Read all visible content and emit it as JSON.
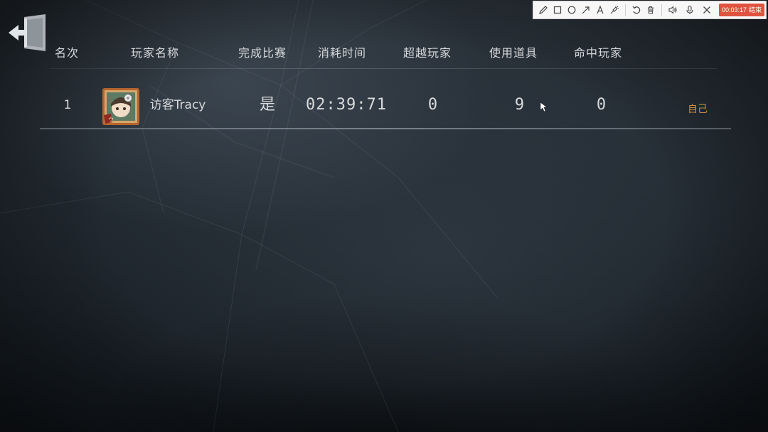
{
  "header": {
    "rank": "名次",
    "player_name": "玩家名称",
    "finished": "完成比赛",
    "time_used": "消耗时间",
    "players_overtaken": "超越玩家",
    "items_used": "使用道具",
    "players_hit": "命中玩家"
  },
  "rows": [
    {
      "rank": "1",
      "player_name": "访客Tracy",
      "finished": "是",
      "time_used": "02:39:71",
      "players_overtaken": "0",
      "items_used": "9",
      "players_hit": "0",
      "tag": "自己"
    }
  ],
  "toolbar": {
    "icons": [
      "pencil-icon",
      "rectangle-icon",
      "circle-icon",
      "arrow-icon",
      "text-icon",
      "highlighter-icon",
      "undo-icon",
      "trash-icon",
      "speaker-icon",
      "microphone-icon",
      "close-icon"
    ],
    "timer": "00:03:17",
    "end_label": "结束"
  },
  "colors": {
    "self_tag": "#c98b45",
    "timer_bg": "#e0533f",
    "text": "#d8dadc"
  }
}
